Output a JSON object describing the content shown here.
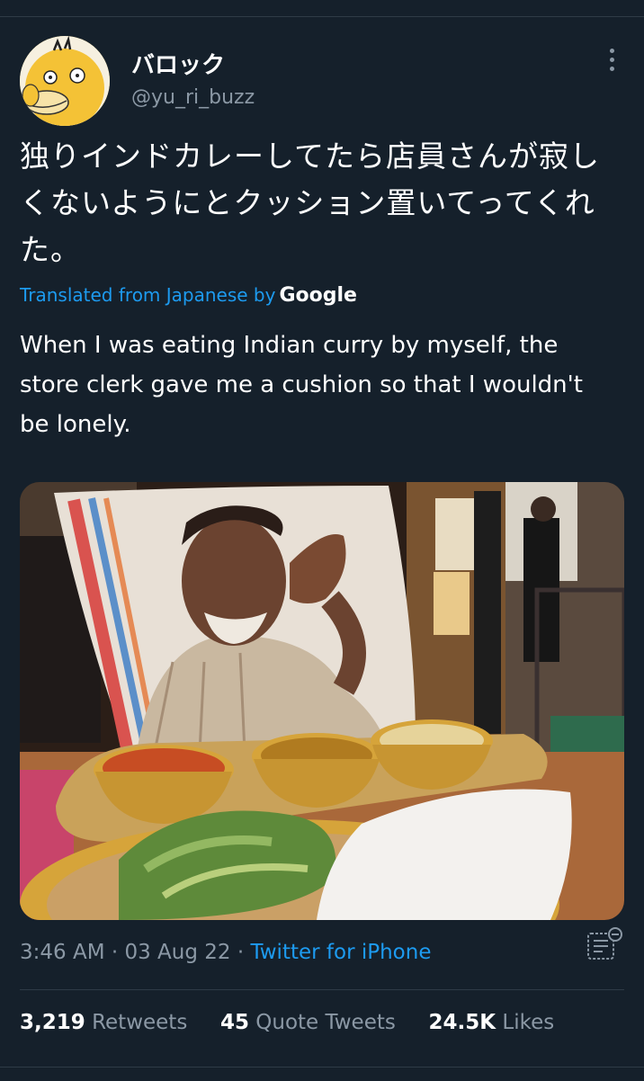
{
  "tweet": {
    "display_name": "バロック",
    "handle": "@yu_ri_buzz",
    "text_original": "独りインドカレーしてたら店員さんが寂しくないようにとクッション置いてってくれた。",
    "translated_label": "Translated from Japanese by",
    "translation_provider": "Google",
    "text_translated": "When I was eating Indian curry by myself, the store clerk gave me a cushion so that I wouldn't be lonely.",
    "time": "3:46 AM",
    "date": "03 Aug 22",
    "source": "Twitter for iPhone",
    "separator": "·"
  },
  "stats": {
    "retweets_count": "3,219",
    "retweets_label": "Retweets",
    "quotes_count": "45",
    "quotes_label": "Quote Tweets",
    "likes_count": "24.5K",
    "likes_label": "Likes"
  },
  "icons": {
    "more": "more-vertical-icon",
    "analytics": "analytics-icon"
  },
  "colors": {
    "background": "#15202b",
    "link": "#1d9bf0",
    "secondary_text": "#8b98a5",
    "divider": "#2f3b47"
  }
}
